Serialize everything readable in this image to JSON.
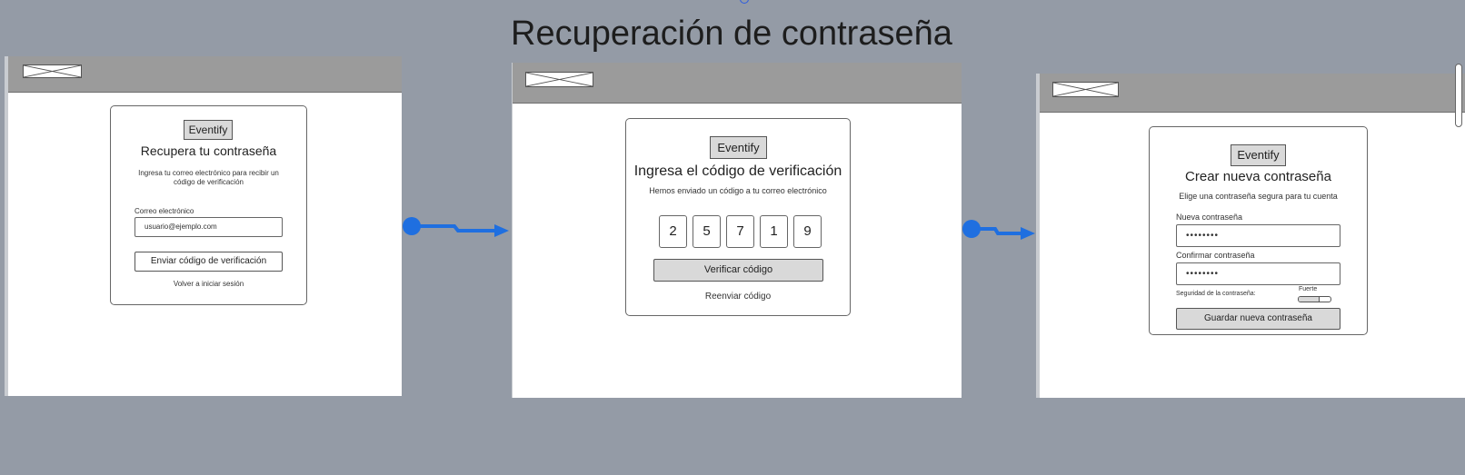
{
  "page": {
    "title": "Recuperación de contraseña"
  },
  "screen1": {
    "brand": "Eventify",
    "heading": "Recupera tu contraseña",
    "description_line1": "Ingresa tu correo electrónico para recibir un",
    "description_line2": "código de verificación",
    "email_label": "Correo electrónico",
    "email_value": "usuario@ejemplo.com",
    "submit_label": "Enviar código de verificación",
    "back_link": "Volver a iniciar sesión"
  },
  "screen2": {
    "brand": "Eventify",
    "heading": "Ingresa el código de verificación",
    "description": "Hemos enviado un código a tu correo electrónico",
    "digits": [
      "2",
      "5",
      "7",
      "1",
      "9"
    ],
    "verify_label": "Verificar código",
    "resend_link": "Reenviar código"
  },
  "screen3": {
    "brand": "Eventify",
    "heading": "Crear nueva contraseña",
    "description": "Elige una contraseña segura para tu cuenta",
    "new_password_label": "Nueva contraseña",
    "new_password_value": "••••••••",
    "confirm_password_label": "Confirmar contraseña",
    "confirm_password_value": "••••••••",
    "strength_label": "Seguridad de la contraseña:",
    "strength_value": "Fuerte",
    "strength_level": 0.65,
    "save_label": "Guardar nueva contraseña"
  },
  "colors": {
    "background": "#949ba6",
    "flow_arrow": "#1f6fe0",
    "topbar": "#9b9b9b"
  }
}
